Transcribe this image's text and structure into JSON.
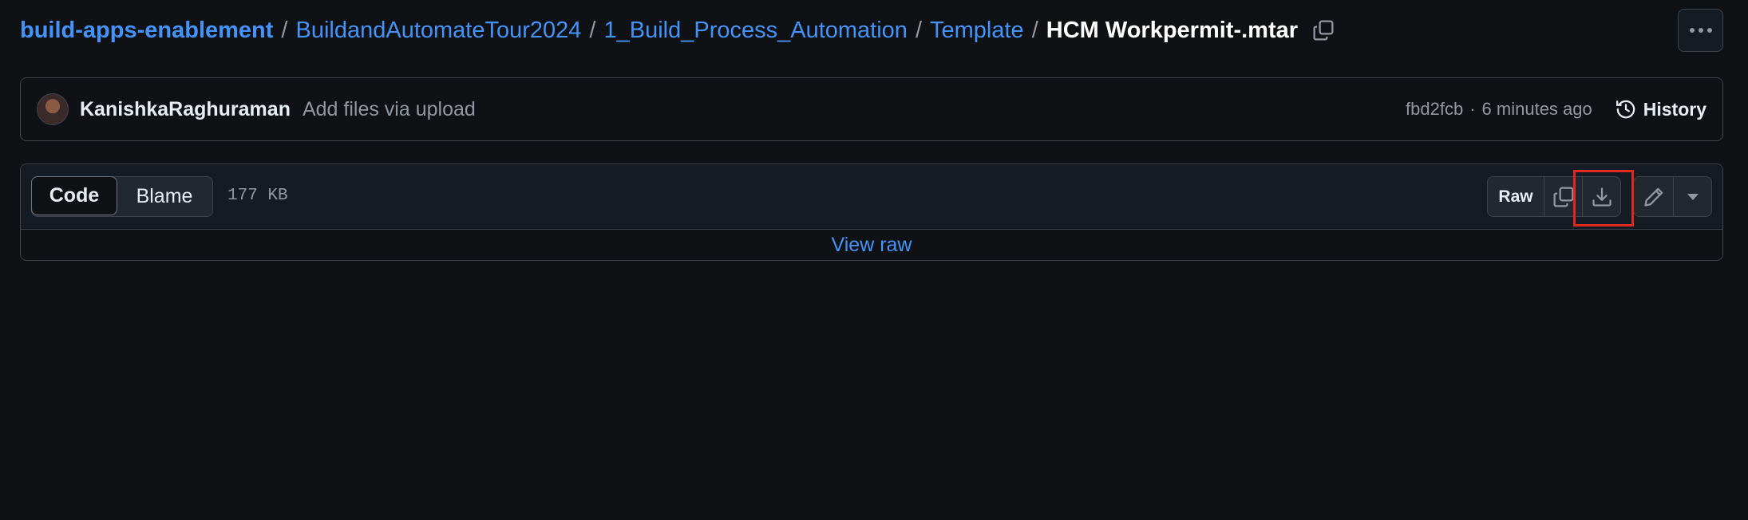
{
  "breadcrumb": {
    "repo": "build-apps-enablement",
    "folder1": "BuildandAutomateTour2024",
    "folder2": "1_Build_Process_Automation",
    "folder3": "Template",
    "file": "HCM Workpermit-.mtar",
    "separator": "/"
  },
  "commit": {
    "author": "KanishkaRaghuraman",
    "message": "Add files via upload",
    "sha": "fbd2fcb",
    "dot": "·",
    "time": "6 minutes ago",
    "history_label": "History"
  },
  "file_view": {
    "tabs": [
      {
        "label": "Code",
        "selected": true
      },
      {
        "label": "Blame",
        "selected": false
      }
    ],
    "size": "177 KB",
    "raw_label": "Raw",
    "view_raw_label": "View raw"
  },
  "icons": {
    "copy_path": "copy-icon",
    "more": "kebab-horizontal-icon",
    "history": "history-icon",
    "copy_raw": "copy-icon",
    "download": "download-icon",
    "edit": "pencil-icon",
    "dropdown": "triangle-down-icon"
  },
  "colors": {
    "background": "#0f1115",
    "link": "#4493f8",
    "muted": "#9198a1",
    "border": "#3d444d",
    "highlight": "#e0281f"
  }
}
